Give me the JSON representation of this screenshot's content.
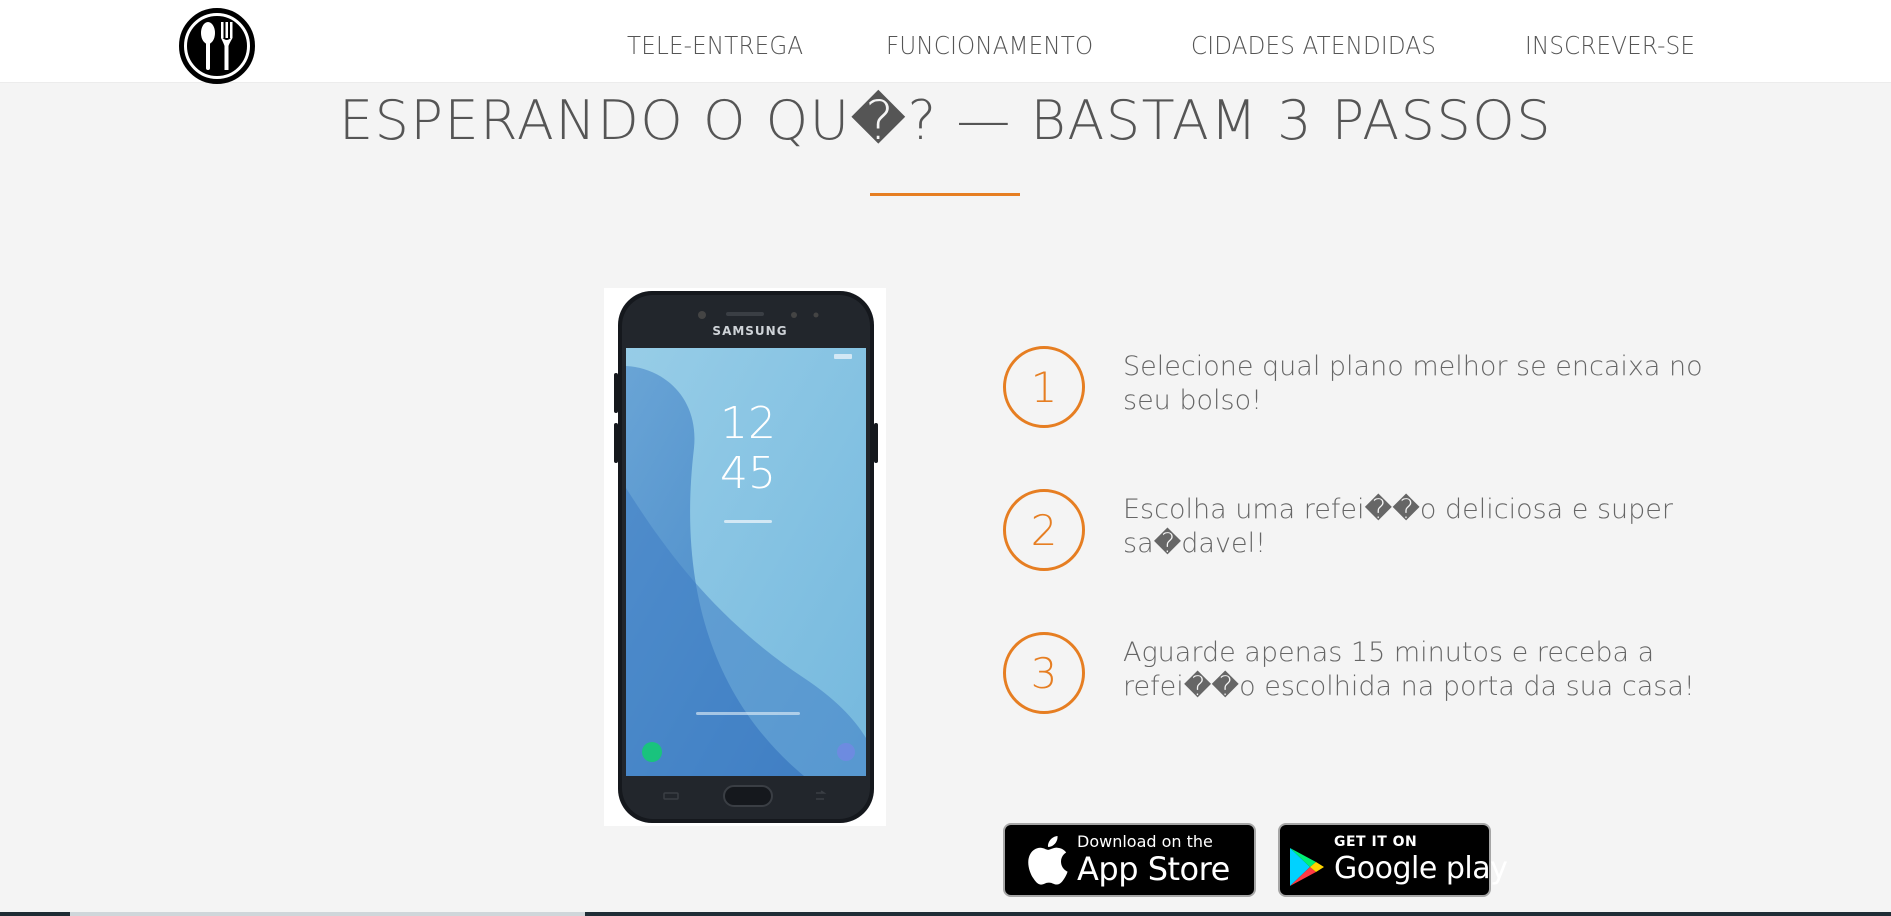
{
  "nav": {
    "links": [
      "TELE-ENTREGA",
      "FUNCIONAMENTO",
      "CIDADES ATENDIDAS",
      "INSCREVER-SE"
    ]
  },
  "section": {
    "title": "ESPERANDO O QU�? — BASTAM 3 PASSOS"
  },
  "phone": {
    "brand": "SAMSUNG",
    "clock_hours": "12",
    "clock_minutes": "45"
  },
  "steps": [
    {
      "number": "1",
      "text": "Selecione qual plano melhor se encaixa no seu bolso!"
    },
    {
      "number": "2",
      "text": "Escolha uma refei��o deliciosa e super sa�davel!"
    },
    {
      "number": "3",
      "text": "Aguarde apenas 15 minutos e receba a refei��o escolhida na porta da sua casa!"
    }
  ],
  "badges": {
    "apple_small": "Download on the",
    "apple_big": "App Store",
    "google_small": "GET IT ON",
    "google_big": "Google play"
  },
  "colors": {
    "accent": "#e67e22",
    "background": "#f4f4f4",
    "nav_background": "#ffffff"
  }
}
